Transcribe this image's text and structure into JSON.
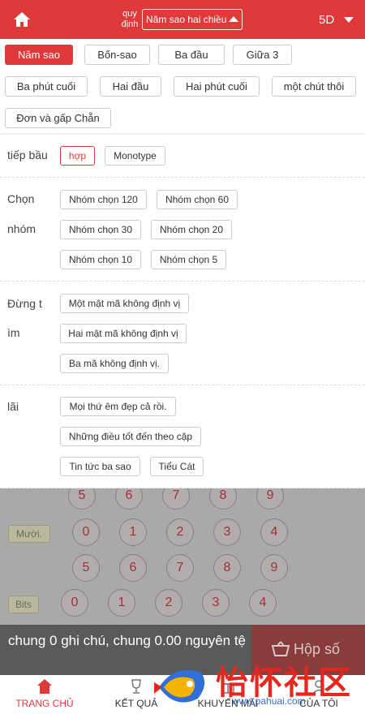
{
  "header": {
    "rule_label": "quy định",
    "rule_value": "Năm sao hai chiều",
    "game": "5D"
  },
  "tabs": [
    {
      "label": "Năm sao"
    },
    {
      "label": "Bốn-sao"
    },
    {
      "label": "Ba đầu"
    },
    {
      "label": "Giữa 3"
    },
    {
      "label": "Ba phút cuối"
    },
    {
      "label": "Hai đầu"
    },
    {
      "label": "Hai phút cuối"
    },
    {
      "label": "một chút thôi"
    },
    {
      "label": "Đơn và gấp Chẵn"
    }
  ],
  "panel": {
    "start_label": "tiếp bầu",
    "start_opts": [
      "hợp",
      "Monotype"
    ],
    "group_label_1": "Chọn",
    "group_label_2": "nhóm",
    "group_opts": [
      "Nhóm chọn 120",
      "Nhóm chọn 60",
      "Nhóm chọn 30",
      "Nhóm chọn 20",
      "Nhóm chọn 10",
      "Nhóm chọn 5"
    ],
    "stop_label_1": "Đừng t",
    "stop_label_2": "ìm",
    "stop_opts": [
      "Một mật mã không định vị",
      "Hai mật mã không định vị",
      "Ba mã không định vị."
    ],
    "profit_label": "lãi",
    "profit_opts": [
      "Mọi thứ êm đẹp cả rồi.",
      "Những điều tốt đến theo cặp",
      "Tin tức ba sao",
      "Tiểu Cát"
    ]
  },
  "balls": {
    "partial_row": [
      "5",
      "6",
      "7",
      "8",
      "9"
    ],
    "row1_tag": "Mười.",
    "row1_a": [
      "0",
      "1",
      "2",
      "3",
      "4"
    ],
    "row1_b": [
      "5",
      "6",
      "7",
      "8",
      "9"
    ],
    "row2_tag": "Bits",
    "row2_a": [
      "0",
      "1",
      "2",
      "3",
      "4"
    ]
  },
  "summary": {
    "text": "chung 0 ghi chú, chung 0.00 nguyên tệ",
    "cart_label": "Hộp số"
  },
  "footer": {
    "items": [
      "TRANG CHỦ",
      "KẾT QUẢ",
      "KHUYẾN MÃI",
      "CỦA TÔI"
    ]
  },
  "watermark": {
    "text": "怡怀社区",
    "sub": "www.pahuai.com"
  },
  "colors": {
    "accent": "#e0393a",
    "overlay": "#a9a9a9"
  }
}
